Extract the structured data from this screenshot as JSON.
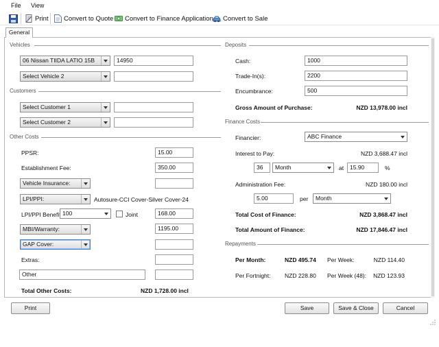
{
  "menu": {
    "file": "File",
    "view": "View"
  },
  "toolbar": {
    "print": "Print",
    "convert_quote": "Convert to Quote",
    "convert_finance": "Convert to Finance Application",
    "convert_sale": "Convert to Sale"
  },
  "tabs": {
    "general": "General"
  },
  "vehicles": {
    "section": "Vehicles",
    "vehicle1": "06 Nissan TIIDA LATIO 15B",
    "vehicle1_value": "14950",
    "vehicle2": "Select Vehicle 2",
    "vehicle2_value": ""
  },
  "customers": {
    "section": "Customers",
    "customer1": "Select Customer 1",
    "customer1_value": "",
    "customer2": "Select Customer 2",
    "customer2_value": ""
  },
  "other_costs": {
    "section": "Other Costs",
    "ppsr_label": "PPSR:",
    "ppsr_value": "15.00",
    "establishment_label": "Establishment Fee:",
    "establishment_value": "350.00",
    "vehicle_insurance": "Vehicle Insurance:",
    "vehicle_insurance_value": "",
    "lpi_ppi": "LPI/PPI:",
    "lpi_ppi_desc": "Autosure-CCI Cover-Silver Cover-24",
    "lpi_benefit_label": "LPI/PPI Benefit:",
    "lpi_benefit_value": "100",
    "joint_label": "Joint",
    "lpi_amount": "168.00",
    "mbi_warranty": "MBI/Warranty:",
    "mbi_value": "1195.00",
    "gap_cover": "GAP Cover:",
    "gap_value": "",
    "extras_label": "Extras:",
    "extras_value": "",
    "other_text": "Other",
    "other_value": "",
    "total_label": "Total Other Costs:",
    "total_value": "NZD 1,728.00 incl"
  },
  "deposits": {
    "section": "Deposits",
    "cash_label": "Cash:",
    "cash_value": "1000",
    "tradein_label": "Trade-In(s):",
    "tradein_value": "2200",
    "encumbrance_label": "Encumbrance:",
    "encumbrance_value": "500",
    "gross_label": "Gross Amount of Purchase:",
    "gross_value": "NZD 13,978.00 incl"
  },
  "finance": {
    "section": "Finance Costs",
    "financier_label": "Financier:",
    "financier_value": "ABC Finance",
    "interest_label": "Interest to Pay:",
    "interest_value": "NZD 3,688.47 incl",
    "term_value": "36",
    "term_unit": "Month",
    "at_label": "at",
    "rate_value": "15.90",
    "percent": "%",
    "admin_label": "Administration Fee:",
    "admin_value": "NZD 180.00 incl",
    "admin_amount": "5.00",
    "per_label": "per",
    "admin_unit": "Month",
    "total_cost_label": "Total Cost of Finance:",
    "total_cost_value": "NZD 3,868.47 incl",
    "total_amount_label": "Total Amount of Finance:",
    "total_amount_value": "NZD 17,846.47 incl"
  },
  "repayments": {
    "section": "Repayments",
    "per_month_label": "Per Month:",
    "per_month_value": "NZD 495.74",
    "per_week_label": "Per Week:",
    "per_week_value": "NZD 114.40",
    "per_fortnight_label": "Per Fortnight:",
    "per_fortnight_value": "NZD 228.80",
    "per_week48_label": "Per Week (48):",
    "per_week48_value": "NZD 123.93"
  },
  "buttons": {
    "print": "Print",
    "save": "Save",
    "save_close": "Save & Close",
    "cancel": "Cancel"
  },
  "colors": {
    "accent": "#3b7dd8",
    "border": "#9a9a9a"
  }
}
